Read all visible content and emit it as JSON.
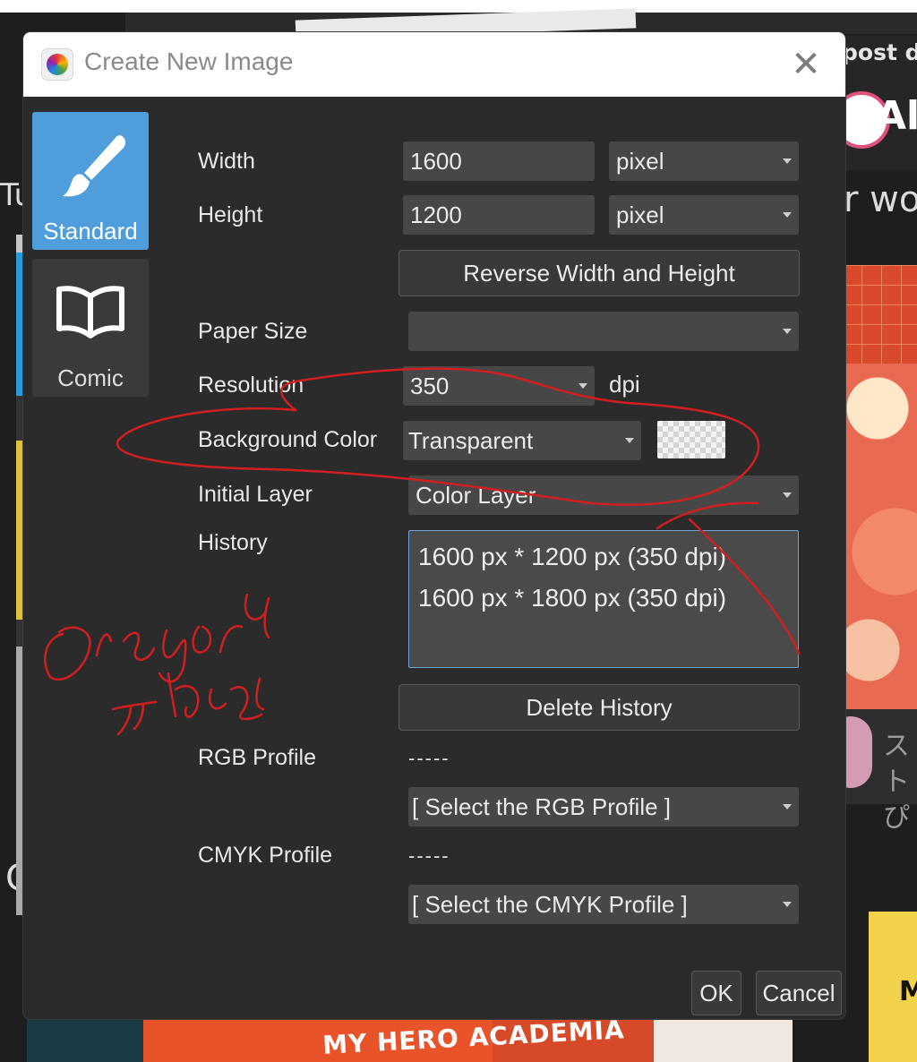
{
  "background": {
    "post_text": "post dir",
    "al_text": "Al",
    "rwo_text": "r wo",
    "tu_text": "Tu",
    "c_text": "C",
    "jp_text_1": "スト",
    "jp_text_2": "ぴ",
    "m_text": "M",
    "bottom_title": "MY HERO ACADEMIA"
  },
  "dialog": {
    "title": "Create New Image",
    "close_symbol": "✕",
    "tabs": [
      {
        "label": "Standard",
        "icon": "paintbrush-icon",
        "active": true
      },
      {
        "label": "Comic",
        "icon": "open-book-icon",
        "active": false
      }
    ],
    "width": {
      "label": "Width",
      "value": "1600",
      "unit": "pixel"
    },
    "height": {
      "label": "Height",
      "value": "1200",
      "unit": "pixel"
    },
    "reverse_button": "Reverse Width and Height",
    "paper_size": {
      "label": "Paper Size",
      "value": ""
    },
    "resolution": {
      "label": "Resolution",
      "value": "350",
      "unit": "dpi"
    },
    "background_color": {
      "label": "Background Color",
      "value": "Transparent"
    },
    "initial_layer": {
      "label": "Initial Layer",
      "value": "Color Layer"
    },
    "history": {
      "label": "History",
      "items": [
        "1600 px * 1200 px (350 dpi)",
        "1600 px * 1800 px (350 dpi)"
      ]
    },
    "delete_history_button": "Delete History",
    "rgb_profile": {
      "label": "RGB Profile",
      "value": "-----",
      "select": "[ Select the RGB Profile ]"
    },
    "cmyk_profile": {
      "label": "CMYK Profile",
      "value": "-----",
      "select": "[ Select the CMYK Profile ]"
    },
    "ok_button": "OK",
    "cancel_button": "Cancel"
  },
  "colors": {
    "accent_tab": "#4f9edb",
    "dialog_bg": "#2b2b2b",
    "field_bg": "#474747",
    "annotation_red": "#d11f1f"
  }
}
